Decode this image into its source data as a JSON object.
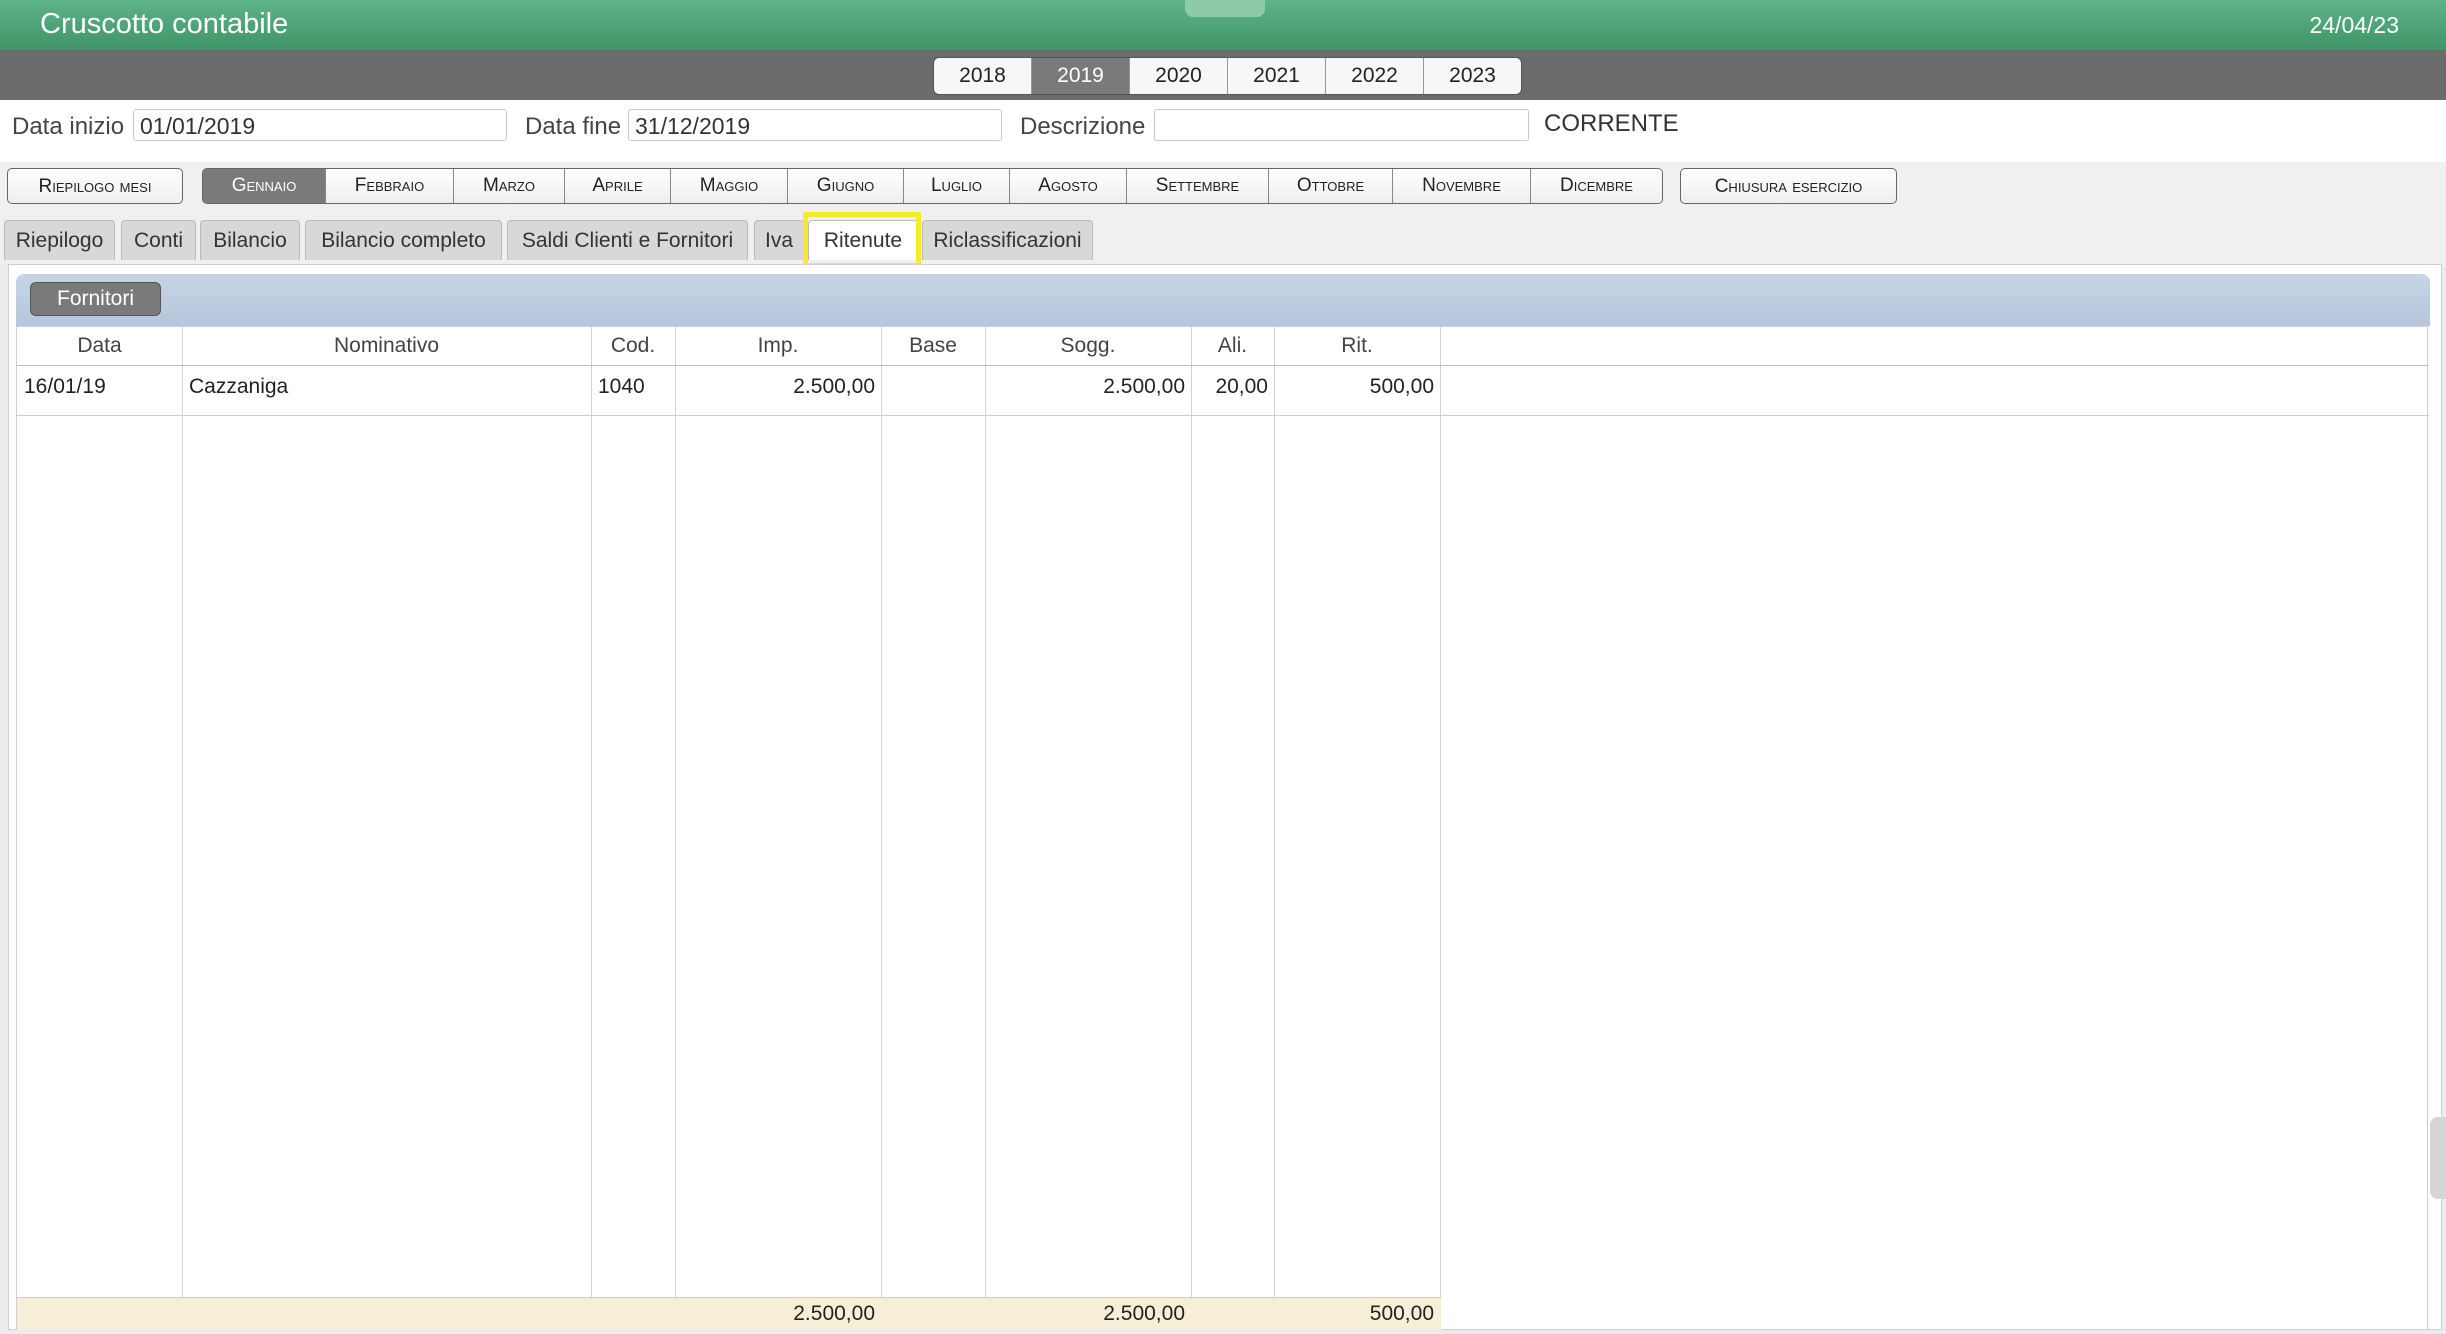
{
  "app": {
    "title": "Cruscotto contabile",
    "date": "24/04/23"
  },
  "years": {
    "items": [
      "2018",
      "2019",
      "2020",
      "2021",
      "2022",
      "2023"
    ],
    "active": "2019"
  },
  "filters": {
    "start_label": "Data inizio",
    "start_value": "01/01/2019",
    "end_label": "Data fine",
    "end_value": "31/12/2019",
    "description_label": "Descrizione",
    "description_value": "",
    "status": "CORRENTE"
  },
  "months": {
    "summary_label": "Riepilogo mesi",
    "items": [
      "Gennaio",
      "Febbraio",
      "Marzo",
      "Aprile",
      "Maggio",
      "Giugno",
      "Luglio",
      "Agosto",
      "Settembre",
      "Ottobre",
      "Novembre",
      "Dicembre"
    ],
    "active": "Gennaio",
    "close_label": "Chiusura esercizio"
  },
  "tabs": {
    "items": [
      "Riepilogo",
      "Conti",
      "Bilancio",
      "Bilancio completo",
      "Saldi Clienti e Fornitori",
      "Iva",
      "Ritenute",
      "Riclassificazioni"
    ],
    "active": "Ritenute"
  },
  "section": {
    "button_label": "Fornitori"
  },
  "table": {
    "columns": [
      "Data",
      "Nominativo",
      "Cod.",
      "Imp.",
      "Base",
      "Sogg.",
      "Ali.",
      "Rit."
    ],
    "rows": [
      [
        "16/01/19",
        "Cazzaniga",
        "1040",
        "2.500,00",
        "",
        "2.500,00",
        "20,00",
        "500,00"
      ]
    ],
    "totals": {
      "imp": "2.500,00",
      "sogg": "2.500,00",
      "rit": "500,00"
    }
  },
  "colors": {
    "title_green": "#4aa273",
    "active_gray": "#7a7a7a",
    "highlight": "#f6ea2c",
    "totals_bg": "#f7efd5"
  }
}
